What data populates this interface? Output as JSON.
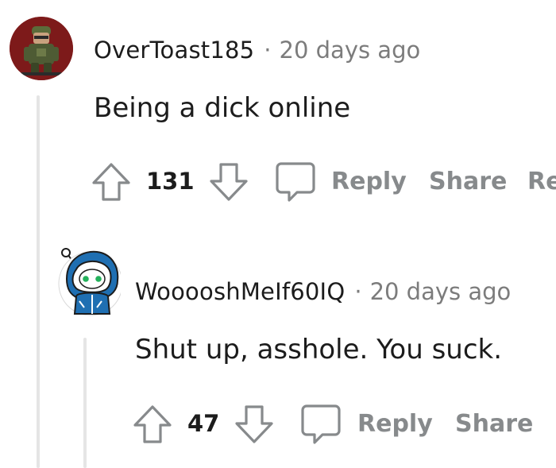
{
  "comments": [
    {
      "author": "OverToast185",
      "separator": "·",
      "time": "20 days ago",
      "body": "Being a dick online",
      "score": "131",
      "actions": {
        "reply": "Reply",
        "share": "Share",
        "more": "Re"
      }
    },
    {
      "author": "WooooshMeIf60IQ",
      "separator": "·",
      "time": "20 days ago",
      "body": "Shut up, asshole. You suck.",
      "score": "47",
      "actions": {
        "reply": "Reply",
        "share": "Share"
      }
    }
  ],
  "icons": {
    "upvote": "arrow-up-outline",
    "downvote": "arrow-down-outline",
    "reply": "speech-bubble-outline",
    "avatar_1": "soldier-avatar",
    "avatar_2": "snoo-parka-avatar"
  },
  "colors": {
    "meta_gray": "#7c7c7c",
    "action_gray": "#878a8c",
    "thread_line": "#e5e5e5",
    "avatar_1_bg": "#8a1d1d",
    "avatar_2_bg": "#ffffff"
  }
}
